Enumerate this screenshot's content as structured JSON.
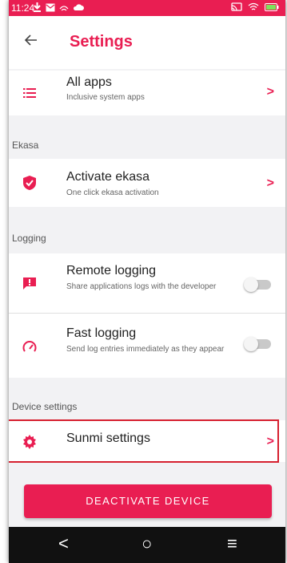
{
  "status_bar": {
    "time": "11:24",
    "left_icons": [
      "download-icon",
      "mail-icon",
      "hotspot-icon",
      "cloud-icon"
    ],
    "right_icons": [
      "cast-icon",
      "wifi-icon",
      "battery-icon"
    ]
  },
  "app_bar": {
    "title": "Settings",
    "back_icon": "arrow-left-icon"
  },
  "items": {
    "all_apps": {
      "title": "All apps",
      "subtitle": "Inclusive system apps",
      "icon": "list-icon"
    },
    "ekasa_section": "Ekasa",
    "activate_ekasa": {
      "title": "Activate ekasa",
      "subtitle": "One click ekasa activation",
      "icon": "shield-check-icon"
    },
    "logging_section": "Logging",
    "remote_logging": {
      "title": "Remote logging",
      "subtitle": "Share applications logs with the developer",
      "icon": "alert-chat-icon",
      "enabled": false
    },
    "fast_logging": {
      "title": "Fast logging",
      "subtitle": "Send log entries immediately as they appear",
      "icon": "gauge-icon",
      "enabled": false
    },
    "device_section": "Device settings",
    "sunmi_settings": {
      "title": "Sunmi settings",
      "icon": "gear-icon"
    }
  },
  "chevron": ">",
  "deactivate_button": "DEACTIVATE DEVICE",
  "nav_bar": {
    "back": "<",
    "home": "○",
    "menu": "≡"
  },
  "colors": {
    "accent": "#e91e52",
    "background": "#f2f2f4",
    "highlight": "#d6202f"
  }
}
